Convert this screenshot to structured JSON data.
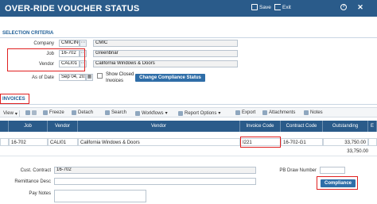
{
  "header": {
    "title": "OVER-RIDE VOUCHER STATUS",
    "save_label": "Save",
    "exit_label": "Exit",
    "help_icon": "help-icon",
    "close_icon": "close-icon"
  },
  "selection": {
    "heading": "SELECTION CRITERIA",
    "company_label": "Company",
    "company_value": "CMICINC",
    "company_name": "CMIC",
    "job_label": "Job",
    "job_value": "16-702",
    "job_name": "Greenbriar",
    "vendor_label": "Vendor",
    "vendor_value": "CALI01",
    "vendor_name": "California Windows & Doors",
    "as_of_label": "As of Date",
    "as_of_value": "Sep 04, 2017",
    "show_closed_label_1": "Show Closed",
    "show_closed_label_2": "Invoices",
    "change_button": "Change Compliance Status"
  },
  "invoices": {
    "heading": "INVOICES",
    "toolbar": {
      "view": "View",
      "freeze": "Freeze",
      "detach": "Detach",
      "search": "Search",
      "workflows": "Workflows",
      "report_options": "Report Options",
      "export": "Export",
      "attachments": "Attachments",
      "notes": "Notes"
    },
    "columns": [
      "Job",
      "Vendor",
      "Vendor",
      "Invoice Code",
      "Contract Code",
      "Outstanding",
      "E"
    ],
    "row": {
      "job": "16-702",
      "vendor_code": "CALI01",
      "vendor_name": "California Windows & Doors",
      "invoice_code": "I221",
      "contract_code": "16-702-G1",
      "outstanding": "33,750.00"
    },
    "total": "33,750.00"
  },
  "detail": {
    "cust_contract_label": "Cust. Contract",
    "cust_contract_value": "16-702",
    "remittance_label": "Remittance Desc",
    "pay_notes_label": "Pay Notes",
    "pb_draw_label": "PB Draw Number",
    "compliance_button": "Compliance"
  },
  "colors": {
    "header_bg": "#2a5b8a",
    "highlight": "#e02020",
    "button_bg": "#2f6ea8"
  }
}
